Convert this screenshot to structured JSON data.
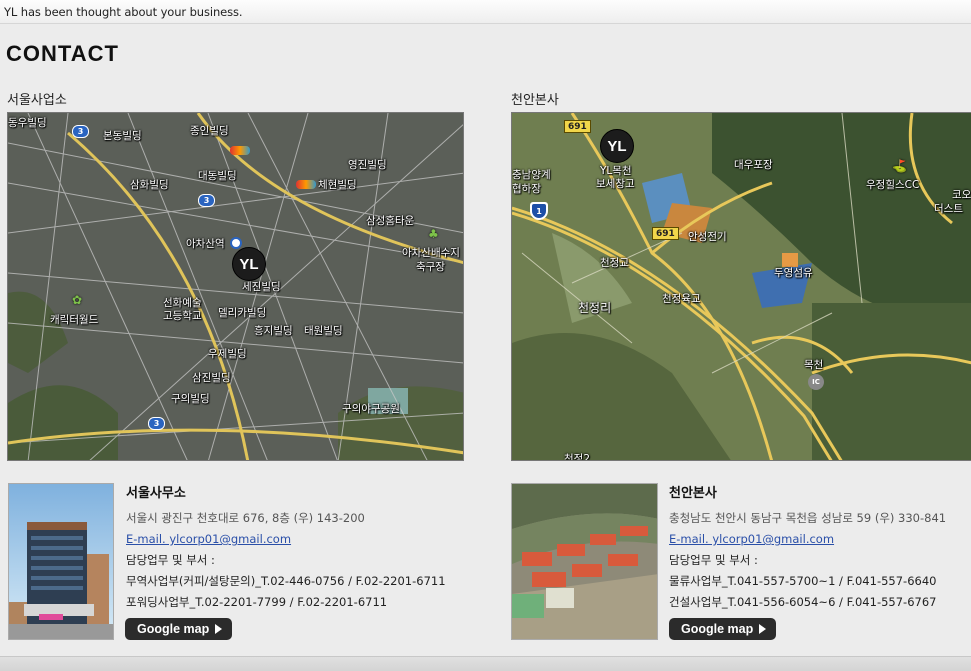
{
  "header": {
    "tagline": "YL has been thought about your business."
  },
  "page_title": "CONTACT",
  "seoul": {
    "section_title": "서울사업소",
    "map": {
      "pin": "YL",
      "labels": [
        "동우빌딩",
        "본동빌딩",
        "종인빌딩",
        "대동빌딩",
        "영진빌딩",
        "체현빌딩",
        "삼화빌딩",
        "삼성홈타운",
        "아차산역",
        "아차산배수지",
        "축구장",
        "세진빌딩",
        "선화예술",
        "고등학교",
        "델리카빌딩",
        "캐릭터월드",
        "흥지빌딩",
        "태원빌딩",
        "우제빌딩",
        "삼진빌딩",
        "구의빌딩",
        "구의야구공원"
      ],
      "route_numbers": [
        "3",
        "3",
        "3"
      ]
    },
    "office_name": "서울사무소",
    "address": "서울시 광진구 천호대로 676, 8층 (우) 143-200",
    "email": "E-mail. ylcorp01@gmail.com",
    "dept_heading": "담당업무 및 부서 :",
    "departments": [
      "무역사업부(커피/설탕문의)_T.02-446-0756 / F.02-2201-6711",
      "포워딩사업부_T.02-2201-7799 / F.02-2201-6711"
    ],
    "button": "Google map"
  },
  "cheonan": {
    "section_title": "천안본사",
    "map": {
      "pin": "YL",
      "labels": [
        "YL목천",
        "보세창고",
        "대우포장",
        "우정힐스CC",
        "코오",
        "더스트",
        "충남양계",
        "협하장",
        "안성전기",
        "천정교",
        "두영섬유",
        "천정리",
        "천정육교",
        "목천",
        "천정2"
      ],
      "route_numbers": [
        "691",
        "691",
        "1"
      ],
      "ic_label": "IC"
    },
    "office_name": "천안본사",
    "address": "충청남도 천안시 동남구 목천읍 성남로 59 (우) 330-841",
    "email": "E-mail. ylcorp01@gmail.com",
    "dept_heading": "담당업무 및 부서 :",
    "departments": [
      "물류사업부_T.041-557-5700~1 / F.041-557-6640",
      "건설사업부_T.041-556-6054~6 / F.041-557-6767"
    ],
    "button": "Google map"
  }
}
